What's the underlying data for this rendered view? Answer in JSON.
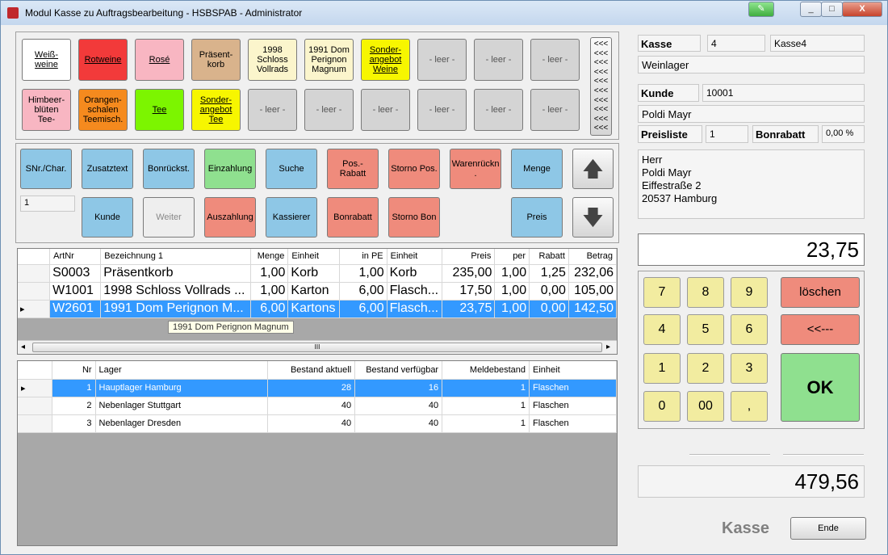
{
  "window": {
    "title": "Modul Kasse zu Auftragsbearbeitung - HSBSPAB - Administrator",
    "minimize": "_",
    "maximize": "□",
    "close": "X",
    "special": "✎"
  },
  "groups": [
    {
      "label": "Weiß-\nweine",
      "color": "#ffffff"
    },
    {
      "label": "Rotweine",
      "color": "#f23a3a"
    },
    {
      "label": "Rosé",
      "color": "#f8b6c2"
    },
    {
      "label": "Präsent-\nkorb",
      "color": "#d9b38c"
    },
    {
      "label": "1998\nSchloss\nVollrads",
      "color": "#fbf5cc"
    },
    {
      "label": "1991 Dom\nPerignon\nMagnum",
      "color": "#fbf5cc"
    },
    {
      "label": "Sonder-\nangebot\nWeine",
      "color": "#f7f600"
    },
    {
      "label": "- leer -"
    },
    {
      "label": "- leer -"
    },
    {
      "label": "- leer -"
    },
    {
      "label": "Himbeer-\nblüten\nTee-",
      "color": "#f8b6c2"
    },
    {
      "label": "Orangen-\nschalen\nTeemisch.",
      "color": "#f58a1e"
    },
    {
      "label": "Tee",
      "color": "#7cf500"
    },
    {
      "label": "Sonder-\nangebot\nTee",
      "color": "#f7f600"
    },
    {
      "label": "- leer -"
    },
    {
      "label": "- leer -"
    },
    {
      "label": "- leer -"
    },
    {
      "label": "- leer -"
    },
    {
      "label": "- leer -"
    },
    {
      "label": "- leer -"
    }
  ],
  "scroll_more": "<<<\n<<<\n<<<\n<<<\n<<<\n<<<\n<<<\n<<<\n<<<\n<<<",
  "functions": {
    "snr": "SNr./Char.",
    "zusatztext": "Zusatztext",
    "bonrueckst": "Bonrückst.",
    "einzahlung": "Einzahlung",
    "suche": "Suche",
    "posrabatt": "Pos.-Rabatt",
    "stornopos": "Storno Pos.",
    "warenrueckn": "Warenrückn\n.",
    "menge": "Menge",
    "kunde": "Kunde",
    "weiter": "Weiter",
    "auszahlung": "Auszahlung",
    "kassierer": "Kassierer",
    "bonrabatt": "Bonrabatt",
    "stornobon": "Storno Bon",
    "preis": "Preis",
    "qty_field": "1",
    "up": "🡅",
    "down": "🡇"
  },
  "positions": {
    "headers": [
      "ArtNr",
      "Bezeichnung 1",
      "Menge",
      "Einheit",
      "in PE",
      "Einheit",
      "Preis",
      "per",
      "Rabatt",
      "Betrag"
    ],
    "rows": [
      [
        "S0003",
        "Präsentkorb",
        "1,00",
        "Korb",
        "1,00",
        "Korb",
        "235,00",
        "1,00",
        "1,25",
        "232,06"
      ],
      [
        "W1001",
        "1998 Schloss Vollrads ...",
        "1,00",
        "Karton",
        "6,00",
        "Flasch...",
        "17,50",
        "1,00",
        "0,00",
        "105,00"
      ],
      [
        "W2601",
        "1991 Dom Perignon M...",
        "6,00",
        "Kartons",
        "6,00",
        "Flasch...",
        "23,75",
        "1,00",
        "0,00",
        "142,50"
      ]
    ],
    "tooltip": "1991 Dom Perignon Magnum",
    "scroll_grip": "III"
  },
  "stock": {
    "headers": [
      "Nr",
      "Lager",
      "Bestand aktuell",
      "Bestand verfügbar",
      "Meldebestand",
      "Einheit"
    ],
    "rows": [
      [
        "1",
        "Hauptlager Hamburg",
        "28",
        "16",
        "1",
        "Flaschen"
      ],
      [
        "2",
        "Nebenlager Stuttgart",
        "40",
        "40",
        "1",
        "Flaschen"
      ],
      [
        "3",
        "Nebenlager Dresden",
        "40",
        "40",
        "1",
        "Flaschen"
      ]
    ]
  },
  "side": {
    "kasse_label": "Kasse",
    "kasse_nr": "4",
    "kasse_name": "Kasse4",
    "lager": "Weinlager",
    "kunde_label": "Kunde",
    "kunde_nr": "10001",
    "kunde_name": "Poldi Mayr",
    "preisliste_label": "Preisliste",
    "preisliste": "1",
    "bonrabatt_label": "Bonrabatt",
    "bonrabatt": "0,00 %",
    "address": [
      "Herr",
      "Poldi Mayr",
      "Eiffestraße 2",
      "20537 Hamburg"
    ],
    "display": "23,75",
    "total": "479,56",
    "footer_label": "Kasse",
    "ende": "Ende"
  },
  "keypad": {
    "k7": "7",
    "k8": "8",
    "k9": "9",
    "k4": "4",
    "k5": "5",
    "k6": "6",
    "k1": "1",
    "k2": "2",
    "k3": "3",
    "k0": "0",
    "k00": "00",
    "kcomma": ",",
    "clear": "löschen",
    "back": "<<---",
    "ok": "OK"
  }
}
